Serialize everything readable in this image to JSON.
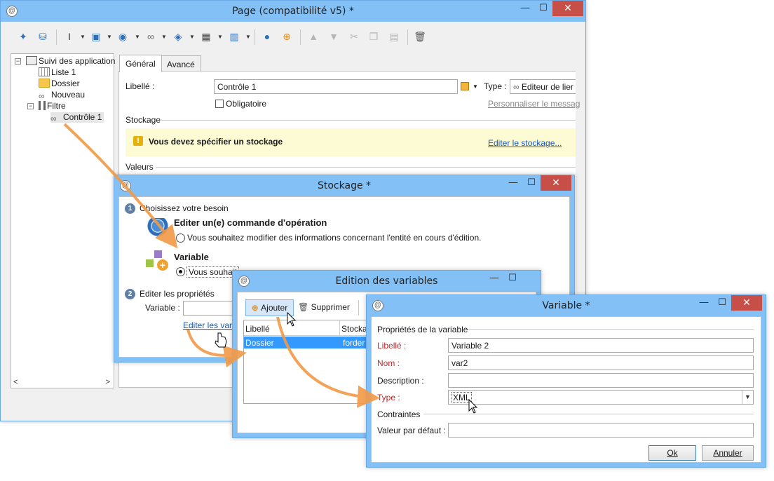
{
  "main_window": {
    "title": "Page (compatibilité v5) *",
    "minimize_glyph": "—",
    "maximize_glyph": "☐",
    "close_glyph": "✕",
    "app_icon_glyph": "@",
    "toolbar": {
      "icons": [
        "magic-wand-icon",
        "database-icon",
        "text-cursor-icon",
        "control-icon",
        "globe-icon",
        "link-icon",
        "cube-icon",
        "table-grid-icon",
        "columns-icon",
        "user-icon",
        "add-icon",
        "arrow-up-icon",
        "arrow-down-icon",
        "cut-icon",
        "copy-icon",
        "paste-icon",
        "delete-icon"
      ],
      "dropdown_glyph": "▼"
    },
    "tree": {
      "items": [
        {
          "label": "Suivi des application",
          "icon": "form-icon",
          "expander": "−"
        },
        {
          "label": "Liste 1",
          "icon": "grid-icon"
        },
        {
          "label": "Dossier",
          "icon": "folder-icon"
        },
        {
          "label": "Nouveau",
          "icon": "link-icon"
        },
        {
          "label": "Filtre",
          "icon": "filter-icon",
          "expander": "−"
        },
        {
          "label": "Contrôle 1",
          "icon": "link-icon"
        }
      ],
      "scroll_left": "<",
      "scroll_right": ">"
    },
    "tabs": [
      "Général",
      "Avancé"
    ],
    "form": {
      "libelle_label": "Libellé :",
      "libelle_value": "Contrôle 1",
      "type_label": "Type :",
      "type_value": "Editeur de lier",
      "obligatoire_label": "Obligatoire",
      "personnaliser_link": "Personnaliser le messag",
      "stockage_section": "Stockage",
      "warning_text": "Vous devez spécifier un stockage",
      "warning_icon": "!",
      "edit_stockage_link": "Editer le stockage...",
      "valeurs_section": "Valeurs"
    }
  },
  "stockage_dialog": {
    "title": "Stockage *",
    "step1_num": "1",
    "step1_label": "Choisissez votre besoin",
    "option1_title": "Editer un(e) commande d'opération",
    "option1_desc": "Vous souhaitez modifier des informations concernant l'entité en cours d'édition.",
    "option2_title": "Variable",
    "option2_desc": "Vous souhait",
    "step2_num": "2",
    "step2_label": "Editer les propriétés",
    "variable_label": "Variable :",
    "edit_vars_link": "Editer les vari"
  },
  "edition_dialog": {
    "title": "Edition des variables",
    "ajouter_label": "Ajouter",
    "supprimer_label": "Supprimer",
    "columns": [
      "Libellé",
      "Stocka"
    ],
    "rows": [
      {
        "libelle": "Dossier",
        "stockage": "forder"
      }
    ]
  },
  "variable_dialog": {
    "title": "Variable *",
    "section_props": "Propriétés de la variable",
    "libelle_label": "Libellé :",
    "libelle_value": "Variable 2",
    "nom_label": "Nom :",
    "nom_value": "var2",
    "description_label": "Description :",
    "description_value": "",
    "type_label": "Type :",
    "type_value": "XML",
    "section_contraintes": "Contraintes",
    "defaut_label": "Valeur par défaut :",
    "defaut_value": "",
    "ok_label": "Ok",
    "annuler_label": "Annuler"
  },
  "colors": {
    "titlebar": "#82c0f5",
    "close_button": "#c74f48",
    "warning_bg": "#fdfbd3",
    "link": "#1a56b3",
    "required_label": "#c0282c",
    "selection": "#3399ff",
    "annotation_arrow": "#f29a46"
  }
}
